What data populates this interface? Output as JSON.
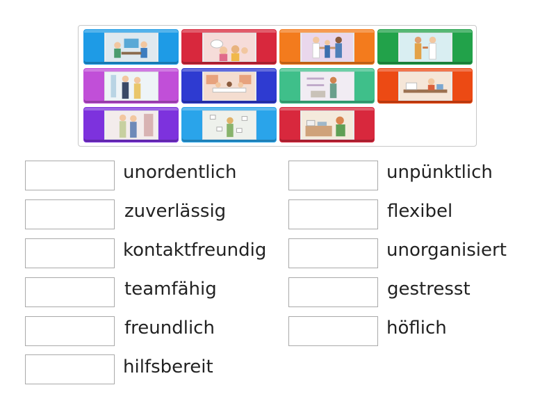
{
  "tiles": [
    {
      "color": "#1e9be6",
      "icon": "office-scene-icon"
    },
    {
      "color": "#d8283d",
      "icon": "people-chatting-icon"
    },
    {
      "color": "#f37b1d",
      "icon": "handshake-icon"
    },
    {
      "color": "#22a24a",
      "icon": "people-talking-icon"
    },
    {
      "color": "#c14fd8",
      "icon": "couple-standing-icon"
    },
    {
      "color": "#2e3bd1",
      "icon": "meeting-room-icon"
    },
    {
      "color": "#3fbf8a",
      "icon": "desk-woman-icon"
    },
    {
      "color": "#ec4a14",
      "icon": "messy-desk-icon"
    },
    {
      "color": "#7d32dd",
      "icon": "people-standing-icon"
    },
    {
      "color": "#2aa4ea",
      "icon": "stressed-worker-icon"
    },
    {
      "color": "#d8283d",
      "icon": "cluttered-office-icon"
    }
  ],
  "left_column": [
    {
      "label": "unordentlich"
    },
    {
      "label": "zuverlässig"
    },
    {
      "label": "kontaktfreundig"
    },
    {
      "label": "teamfähig"
    },
    {
      "label": "freundlich"
    },
    {
      "label": "hilfsbereit"
    }
  ],
  "right_column": [
    {
      "label": "unpünktlich"
    },
    {
      "label": "flexibel"
    },
    {
      "label": "unorganisiert"
    },
    {
      "label": "gestresst"
    },
    {
      "label": "höflich"
    }
  ]
}
